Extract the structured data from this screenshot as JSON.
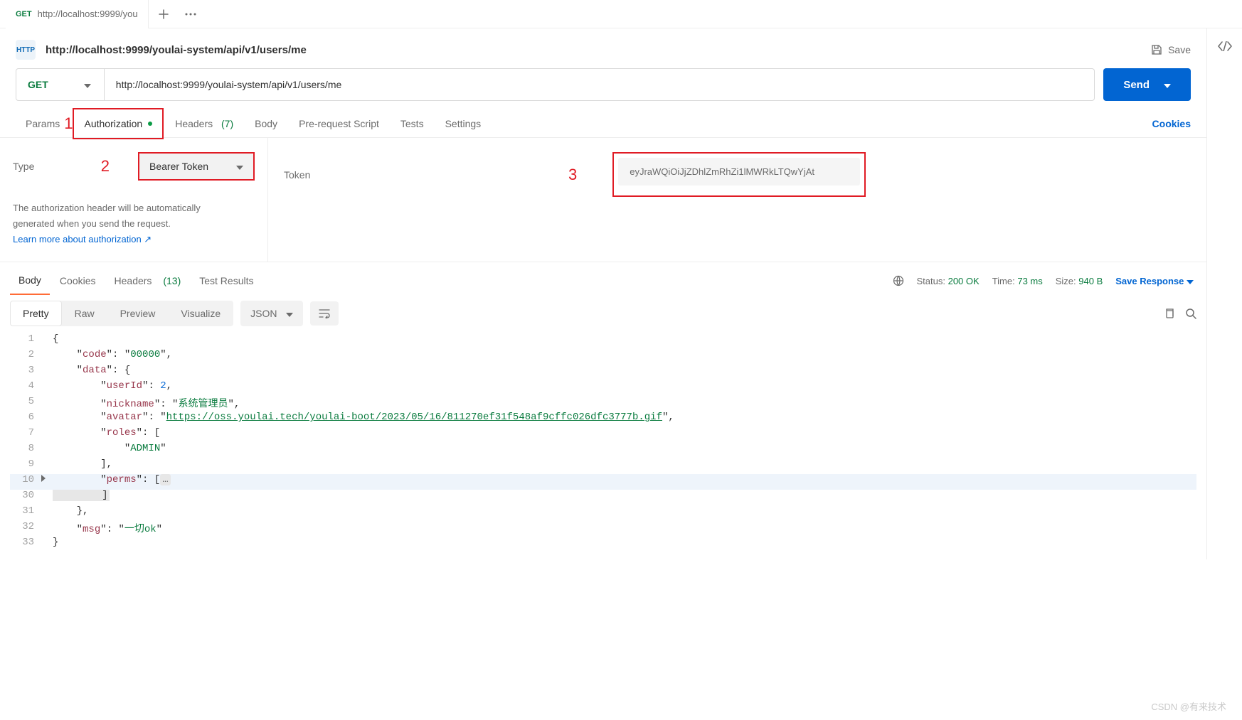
{
  "tabbar": {
    "tab_method": "GET",
    "tab_title": "http://localhost:9999/you"
  },
  "request": {
    "icon_label": "HTTP",
    "title": "http://localhost:9999/youlai-system/api/v1/users/me",
    "save": "Save",
    "method": "GET",
    "url": "http://localhost:9999/youlai-system/api/v1/users/me",
    "send": "Send"
  },
  "req_tabs": {
    "params": "Params",
    "authorization": "Authorization",
    "headers": "Headers",
    "headers_count": "(7)",
    "body": "Body",
    "prerequest": "Pre-request Script",
    "tests": "Tests",
    "settings": "Settings",
    "cookies": "Cookies"
  },
  "annotations": {
    "n1": "1",
    "n2": "2",
    "n3": "3"
  },
  "auth": {
    "type_label": "Type",
    "type_value": "Bearer Token",
    "help_line1": "The authorization header will be automatically",
    "help_line2": "generated when you send the request.",
    "learn_more": "Learn more about authorization ↗",
    "token_label": "Token",
    "token_value": "eyJraWQiOiJjZDhlZmRhZi1lMWRkLTQwYjAt"
  },
  "response": {
    "tabs": {
      "body": "Body",
      "cookies": "Cookies",
      "headers": "Headers",
      "headers_count": "(13)",
      "test_results": "Test Results"
    },
    "status_label": "Status:",
    "status_value": "200 OK",
    "time_label": "Time:",
    "time_value": "73 ms",
    "size_label": "Size:",
    "size_value": "940 B",
    "save_response": "Save Response"
  },
  "view": {
    "pretty": "Pretty",
    "raw": "Raw",
    "preview": "Preview",
    "visualize": "Visualize",
    "json": "JSON"
  },
  "json_body": {
    "code": "00000",
    "data": {
      "userId": 2,
      "nickname": "系统管理员",
      "avatar": "https://oss.youlai.tech/youlai-boot/2023/05/16/811270ef31f548af9cffc026dfc3777b.gif",
      "roles": [
        "ADMIN"
      ],
      "perms": []
    },
    "msg": "一切ok"
  },
  "code_lines": {
    "l1": "{",
    "l2a": "    \"",
    "l2b": "code",
    "l2c": "\": \"",
    "l2d": "00000",
    "l2e": "\",",
    "l3a": "    \"",
    "l3b": "data",
    "l3c": "\": {",
    "l4a": "        \"",
    "l4b": "userId",
    "l4c": "\": ",
    "l4d": "2",
    "l4e": ",",
    "l5a": "        \"",
    "l5b": "nickname",
    "l5c": "\": \"",
    "l5d": "系统管理员",
    "l5e": "\",",
    "l6a": "        \"",
    "l6b": "avatar",
    "l6c": "\": \"",
    "l6d": "https://oss.youlai.tech/youlai-boot/2023/05/16/811270ef31f548af9cffc026dfc3777b.gif",
    "l6e": "\",",
    "l7a": "        \"",
    "l7b": "roles",
    "l7c": "\": [",
    "l8a": "            \"",
    "l8b": "ADMIN",
    "l8c": "\"",
    "l9": "        ],",
    "l10a": "        \"",
    "l10b": "perms",
    "l10c": "\": [",
    "l10d": "…",
    "l30": "        ]",
    "l31": "    },",
    "l32a": "    \"",
    "l32b": "msg",
    "l32c": "\": \"",
    "l32d": "一切ok",
    "l32e": "\"",
    "l33": "}"
  },
  "line_numbers": {
    "n1": "1",
    "n2": "2",
    "n3": "3",
    "n4": "4",
    "n5": "5",
    "n6": "6",
    "n7": "7",
    "n8": "8",
    "n9": "9",
    "n10": "10",
    "n30": "30",
    "n31": "31",
    "n32": "32",
    "n33": "33"
  },
  "watermark": "CSDN @有来技术"
}
